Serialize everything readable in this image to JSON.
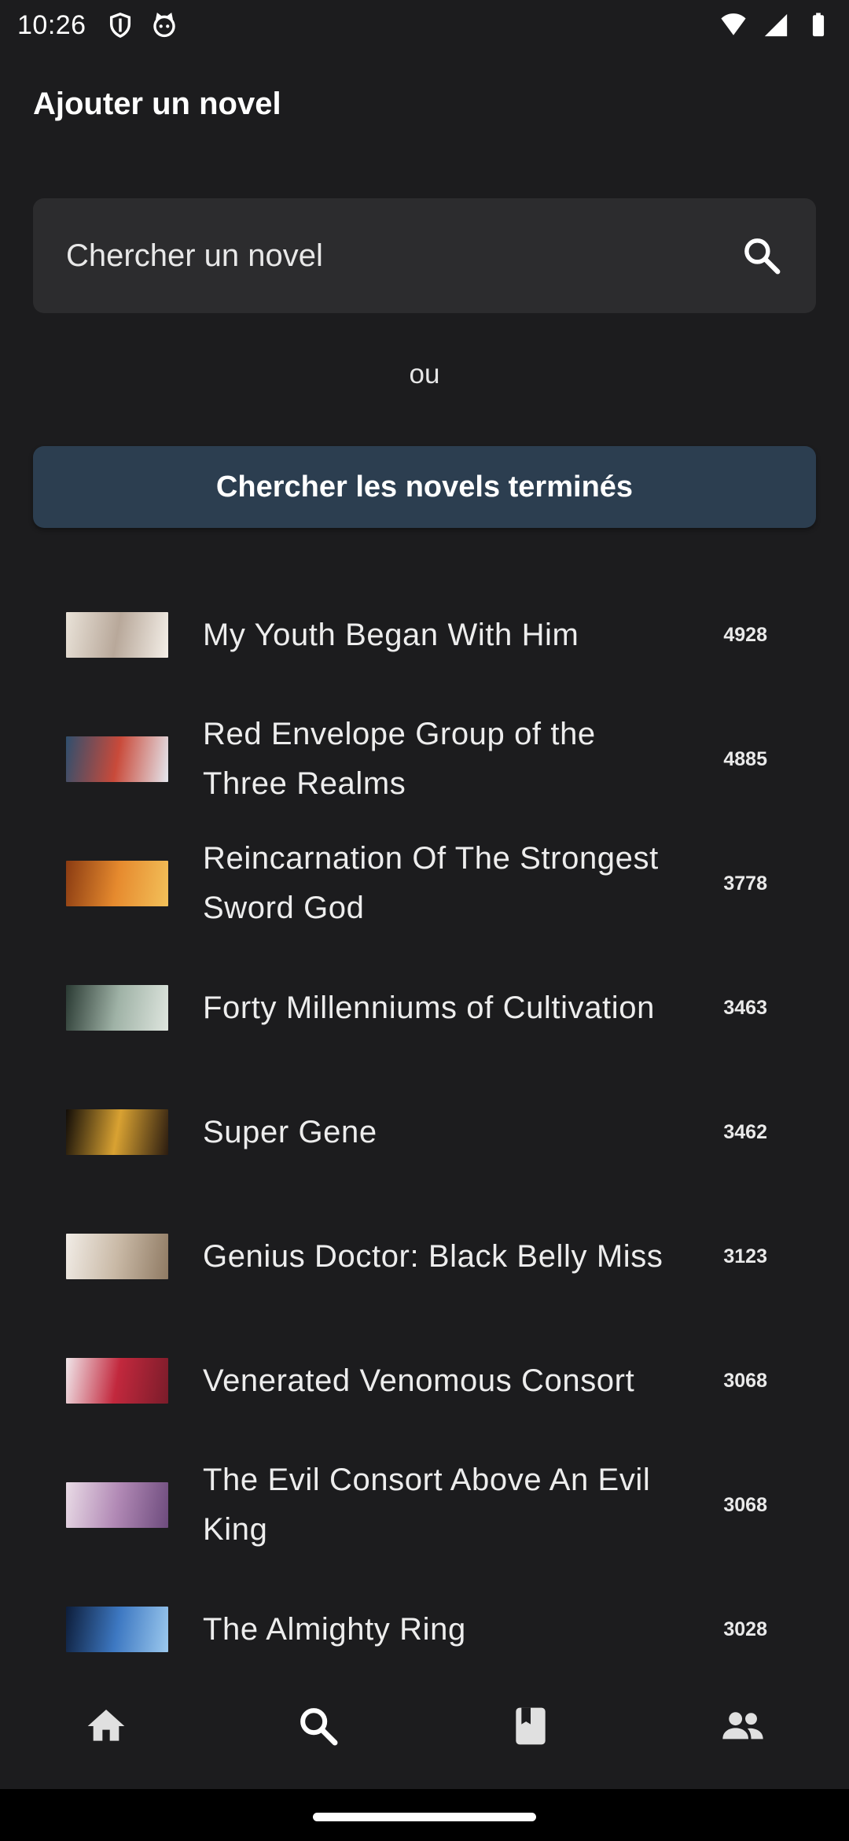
{
  "status_bar": {
    "time": "10:26",
    "icons_left": [
      "shield-icon",
      "cat-face-icon"
    ],
    "icons_right": [
      "wifi-icon",
      "signal-icon",
      "battery-icon"
    ]
  },
  "header": {
    "title": "Ajouter un novel"
  },
  "search": {
    "placeholder": "Chercher un novel",
    "icon": "search-icon"
  },
  "or_label": "ou",
  "finished_button": {
    "label": "Chercher les novels terminés",
    "color": "#2c3e50"
  },
  "novels": [
    {
      "title": "My Youth Began With Him",
      "count": "4928",
      "cover_colors": [
        "#e9e2d8",
        "#b8a89a",
        "#f4efe8"
      ]
    },
    {
      "title": "Red Envelope Group of the Three Realms",
      "count": "4885",
      "cover_colors": [
        "#2f4f6e",
        "#c94a3a",
        "#e4e7ee"
      ]
    },
    {
      "title": "Reincarnation Of The Strongest Sword God",
      "count": "3778",
      "cover_colors": [
        "#8a3b12",
        "#e68a2e",
        "#f3c15a"
      ]
    },
    {
      "title": "Forty Millenniums of Cultivation",
      "count": "3463",
      "cover_colors": [
        "#2a3a33",
        "#9fb2a6",
        "#dfe6df"
      ]
    },
    {
      "title": "Super Gene",
      "count": "3462",
      "cover_colors": [
        "#120d08",
        "#d9a232",
        "#2b1c10"
      ]
    },
    {
      "title": "Genius Doctor: Black Belly Miss",
      "count": "3123",
      "cover_colors": [
        "#f1ece6",
        "#c9b9a6",
        "#8f7a63"
      ]
    },
    {
      "title": "Venerated Venomous Consort",
      "count": "3068",
      "cover_colors": [
        "#f0e6ea",
        "#c2283d",
        "#7a1c2a"
      ]
    },
    {
      "title": "The Evil Consort Above An Evil King",
      "count": "3068",
      "cover_colors": [
        "#e9dbe6",
        "#b189b5",
        "#6d4b7d"
      ]
    },
    {
      "title": "The Almighty Ring",
      "count": "3028",
      "cover_colors": [
        "#0d1d3a",
        "#3d78c2",
        "#9cc9ee"
      ]
    }
  ],
  "bottom_nav": [
    {
      "name": "home",
      "icon": "home-icon",
      "active": false
    },
    {
      "name": "search",
      "icon": "search-icon",
      "active": true
    },
    {
      "name": "library",
      "icon": "book-icon",
      "active": false
    },
    {
      "name": "community",
      "icon": "people-icon",
      "active": false
    }
  ]
}
